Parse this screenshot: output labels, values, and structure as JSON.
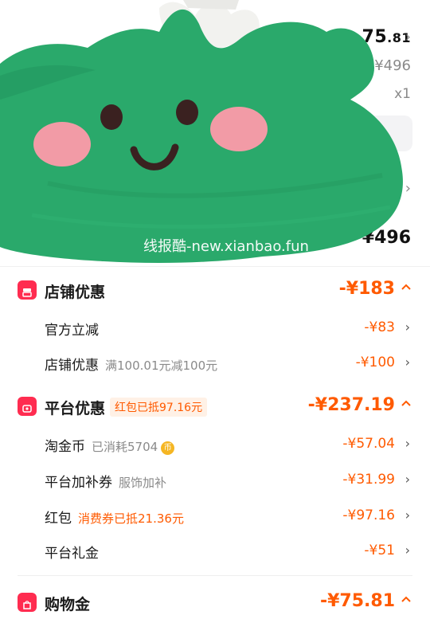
{
  "product": {
    "price_int": "75",
    "price_dec": ".81",
    "original_price": "¥496",
    "quantity": "x1",
    "total": "¥496"
  },
  "watermark": "线报酷-new.xianbao.fun",
  "sections": {
    "store": {
      "title": "店铺优惠",
      "amount": "-¥183",
      "items": [
        {
          "label": "官方立减",
          "note": "",
          "amount": "-¥83"
        },
        {
          "label": "店铺优惠",
          "note": "满100.01元减100元",
          "amount": "-¥100"
        }
      ]
    },
    "platform": {
      "title": "平台优惠",
      "tag": "红包已抵97.16元",
      "amount": "-¥237.19",
      "items": [
        {
          "label": "淘金币",
          "note": "已消耗5704",
          "amount": "-¥57.04"
        },
        {
          "label": "平台加补券",
          "note": "服饰加补",
          "amount": "-¥31.99"
        },
        {
          "label": "红包",
          "note": "消费券已抵21.36元",
          "amount": "-¥97.16"
        },
        {
          "label": "平台礼金",
          "note": "",
          "amount": "-¥51"
        }
      ]
    },
    "shopping_gold": {
      "title": "购物金",
      "amount": "-¥75.81"
    }
  },
  "icons": {
    "coin_glyph": "币",
    "chevron_right": "›",
    "caret_up": "^"
  },
  "colors": {
    "accent": "#ff5a00",
    "section_icon": "#ff2c50",
    "sticker_green": "#2aa96b"
  }
}
